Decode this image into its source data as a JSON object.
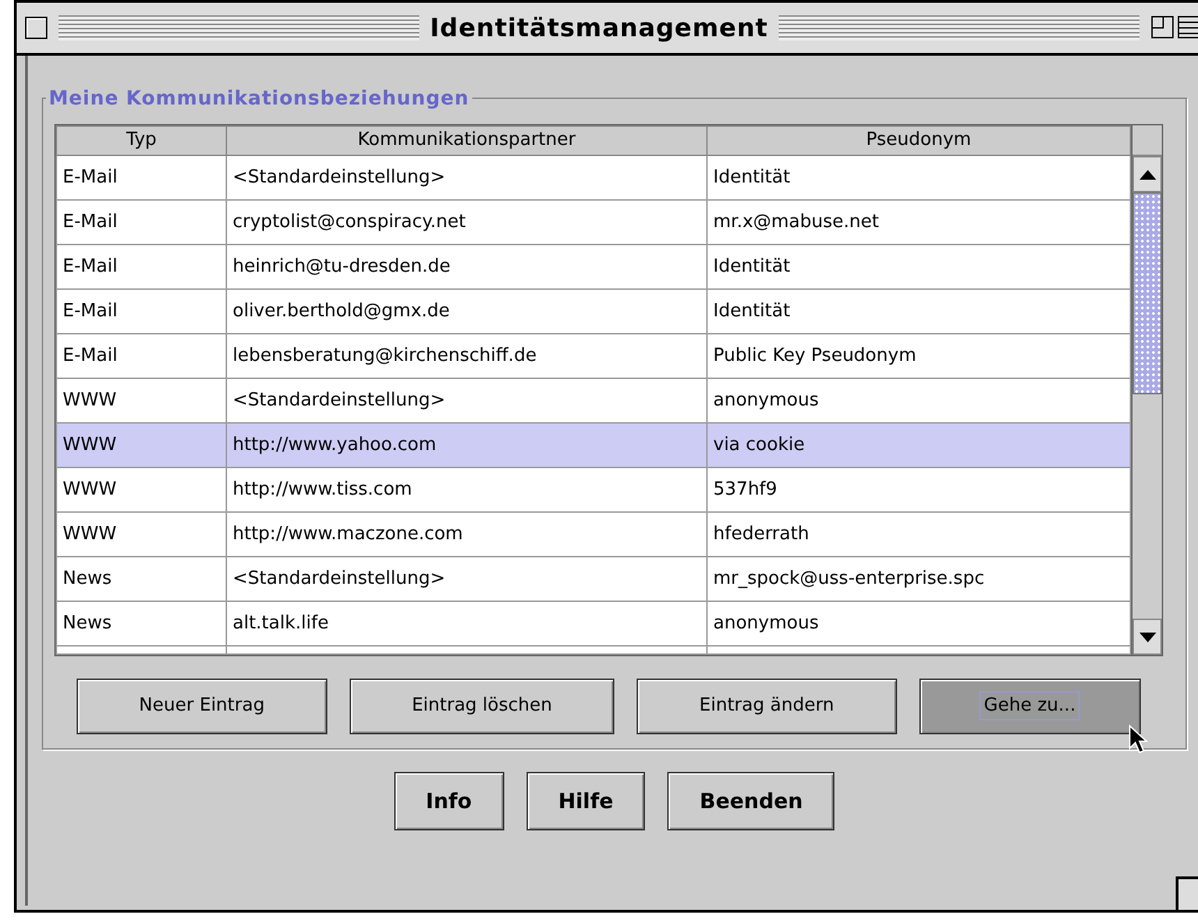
{
  "window": {
    "title": "Identitätsmanagement"
  },
  "group": {
    "title": "Meine Kommunikationsbeziehungen"
  },
  "table": {
    "columns": [
      "Typ",
      "Kommunikationspartner",
      "Pseudonym"
    ],
    "rows": [
      {
        "cells": [
          "E-Mail",
          "<Standardeinstellung>",
          "Identität"
        ],
        "selected": false
      },
      {
        "cells": [
          "E-Mail",
          "cryptolist@conspiracy.net",
          "mr.x@mabuse.net"
        ],
        "selected": false
      },
      {
        "cells": [
          "E-Mail",
          "heinrich@tu-dresden.de",
          "Identität"
        ],
        "selected": false
      },
      {
        "cells": [
          "E-Mail",
          "oliver.berthold@gmx.de",
          "Identität"
        ],
        "selected": false
      },
      {
        "cells": [
          "E-Mail",
          "lebensberatung@kirchenschiff.de",
          "Public Key Pseudonym"
        ],
        "selected": false
      },
      {
        "cells": [
          "WWW",
          "<Standardeinstellung>",
          "anonymous"
        ],
        "selected": false
      },
      {
        "cells": [
          "WWW",
          "http://www.yahoo.com",
          "via cookie"
        ],
        "selected": true
      },
      {
        "cells": [
          "WWW",
          "http://www.tiss.com",
          "537hf9"
        ],
        "selected": false
      },
      {
        "cells": [
          "WWW",
          "http://www.maczone.com",
          "hfederrath"
        ],
        "selected": false
      },
      {
        "cells": [
          "News",
          "<Standardeinstellung>",
          "mr_spock@uss-enterprise.spc"
        ],
        "selected": false
      },
      {
        "cells": [
          "News",
          "alt.talk.life",
          "anonymous"
        ],
        "selected": false
      }
    ]
  },
  "actions": [
    {
      "label": "Neuer Eintrag",
      "pressed": false
    },
    {
      "label": "Eintrag löschen",
      "pressed": false
    },
    {
      "label": "Eintrag ändern",
      "pressed": false
    },
    {
      "label": "Gehe zu...",
      "pressed": true
    }
  ],
  "buttons": [
    "Info",
    "Hilfe",
    "Beenden"
  ]
}
